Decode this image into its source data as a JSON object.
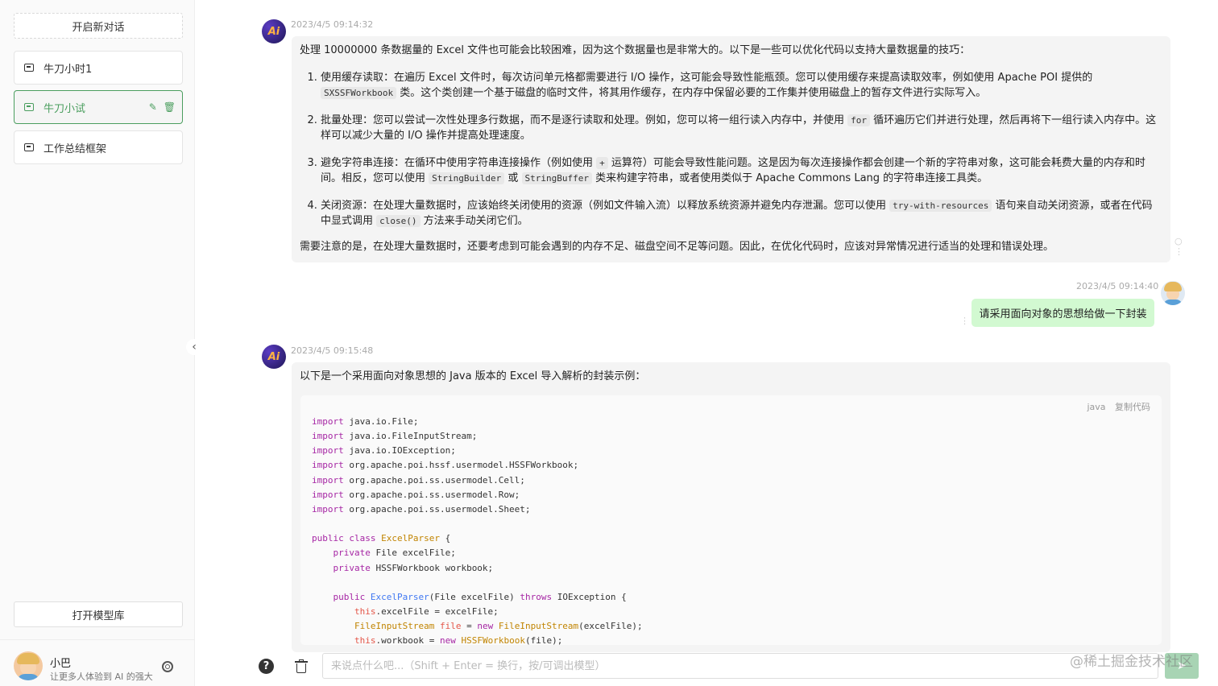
{
  "sidebar": {
    "new_chat_label": "开启新对话",
    "conversations": [
      {
        "title": "牛刀小时1"
      },
      {
        "title": "牛刀小试"
      },
      {
        "title": "工作总结框架"
      }
    ],
    "model_library_label": "打开模型库",
    "user": {
      "name": "小巴",
      "description": "让更多人体验到 AI 的强大"
    }
  },
  "messages": {
    "ai1": {
      "time": "2023/4/5 09:14:32",
      "intro": "处理 10000000 条数据量的 Excel 文件也可能会比较困难，因为这个数据量也是非常大的。以下是一些可以优化代码以支持大量数据量的技巧：",
      "tip1_a": "使用缓存读取：在遍历 Excel 文件时，每次访问单元格都需要进行 I/O 操作，这可能会导致性能瓶颈。您可以使用缓存来提高读取效率，例如使用 Apache POI 提供的 ",
      "tip1_code": "SXSSFWorkbook",
      "tip1_b": " 类。这个类创建一个基于磁盘的临时文件，将其用作缓存，在内存中保留必要的工作集并使用磁盘上的暂存文件进行实际写入。",
      "tip2_a": "批量处理：您可以尝试一次性处理多行数据，而不是逐行读取和处理。例如，您可以将一组行读入内存中，并使用 ",
      "tip2_code": "for",
      "tip2_b": " 循环遍历它们并进行处理，然后再将下一组行读入内存中。这样可以减少大量的 I/O 操作并提高处理速度。",
      "tip3_a": "避免字符串连接：在循环中使用字符串连接操作（例如使用 ",
      "tip3_code1": "+",
      "tip3_b": " 运算符）可能会导致性能问题。这是因为每次连接操作都会创建一个新的字符串对象，这可能会耗费大量的内存和时间。相反，您可以使用 ",
      "tip3_code2": "StringBuilder",
      "tip3_c": " 或 ",
      "tip3_code3": "StringBuffer",
      "tip3_d": " 类来构建字符串，或者使用类似于 Apache Commons Lang 的字符串连接工具类。",
      "tip4_a": "关闭资源：在处理大量数据时，应该始终关闭使用的资源（例如文件输入流）以释放系统资源并避免内存泄漏。您可以使用 ",
      "tip4_code1": "try-with-resources",
      "tip4_b": " 语句来自动关闭资源，或者在代码中显式调用 ",
      "tip4_code2": "close()",
      "tip4_c": " 方法来手动关闭它们。",
      "outro": "需要注意的是，在处理大量数据时，还要考虑到可能会遇到的内存不足、磁盘空间不足等问题。因此，在优化代码时，应该对异常情况进行适当的处理和错误处理。"
    },
    "user1": {
      "time": "2023/4/5 09:14:40",
      "text": "请采用面向对象的思想给做一下封装"
    },
    "ai2": {
      "time": "2023/4/5 09:15:48",
      "intro": "以下是一个采用面向对象思想的 Java 版本的 Excel 导入解析的封装示例：",
      "code_lang": "java",
      "copy_label": "复制代码"
    }
  },
  "code_lines": {
    "l1_kw": "import",
    "l1": " java.io.File;",
    "l2_kw": "import",
    "l2": " java.io.FileInputStream;",
    "l3_kw": "import",
    "l3": " java.io.IOException;",
    "l4_kw": "import",
    "l4": " org.apache.poi.hssf.usermodel.HSSFWorkbook;",
    "l5_kw": "import",
    "l5": " org.apache.poi.ss.usermodel.Cell;",
    "l6_kw": "import",
    "l6": " org.apache.poi.ss.usermodel.Row;",
    "l7_kw": "import",
    "l7": " org.apache.poi.ss.usermodel.Sheet;",
    "l9_kw": "public class",
    "l9_cls": "ExcelParser",
    "l9": " {",
    "l10_kw": "private",
    "l10": " File excelFile;",
    "l11_kw": "private",
    "l11": " HSSFWorkbook workbook;",
    "l13_kw": "public",
    "l13_fn": "ExcelParser",
    "l13_a": "(File excelFile) ",
    "l13_th": "throws",
    "l13_b": " IOException {",
    "l14_th": "this",
    "l14": ".excelFile = excelFile;",
    "l15_cls": "FileInputStream",
    "l15_var": "file",
    "l15_a": " = ",
    "l15_kw": "new",
    "l15_fn": "FileInputStream",
    "l15_b": "(excelFile);",
    "l16_th": "this",
    "l16_a": ".workbook = ",
    "l16_kw": "new",
    "l16_cls": "HSSFWorkbook",
    "l16_b": "(file);"
  },
  "input": {
    "placeholder": "来说点什么吧...（Shift + Enter = 换行，按/可调出模型）"
  },
  "watermark": "@稀土掘金技术社区",
  "colors": {
    "accent": "#4b9e5f",
    "user_bubble": "#d2f9d1",
    "ai_bubble": "#f4f4f4"
  },
  "icons": [
    "chat-icon",
    "edit-icon",
    "delete-icon",
    "gear-icon",
    "chevron-left-icon",
    "help-icon",
    "trash-icon",
    "send-icon"
  ]
}
